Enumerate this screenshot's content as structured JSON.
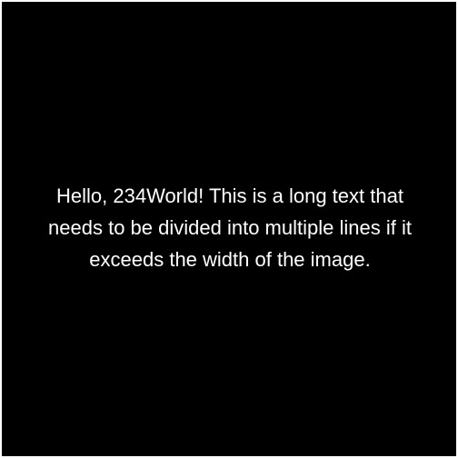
{
  "text": {
    "lines": [
      "Hello, 234World! This is a long text that",
      "needs to be divided into multiple lines if it",
      "exceeds the width of the image."
    ]
  },
  "colors": {
    "background": "#000000",
    "text": "#ffffff",
    "border": "#ffffff"
  }
}
